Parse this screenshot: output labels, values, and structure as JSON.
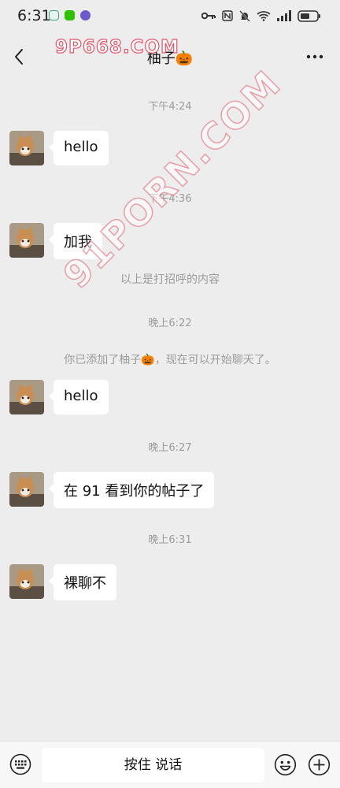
{
  "status_bar": {
    "time": "6:31"
  },
  "nav": {
    "title": "柚子🎃"
  },
  "watermarks": {
    "top": "9P668.COM",
    "diagonal": "91PORN.COM"
  },
  "messages": {
    "ts1": "下午4:24",
    "m1": "hello",
    "ts2": "下午4:36",
    "m2": "加我",
    "sys1": "以上是打招呼的内容",
    "ts3": "晚上6:22",
    "sys2": "你已添加了柚子🎃，现在可以开始聊天了。",
    "m3": "hello",
    "ts4": "晚上6:27",
    "m4": "在 91 看到你的帖子了",
    "ts5": "晚上6:31",
    "m5": "裸聊不"
  },
  "input_bar": {
    "voice_label": "按住 说话"
  },
  "colors": {
    "background": "#ededed",
    "bubble": "#ffffff",
    "timestamp": "#9b9b9b"
  }
}
